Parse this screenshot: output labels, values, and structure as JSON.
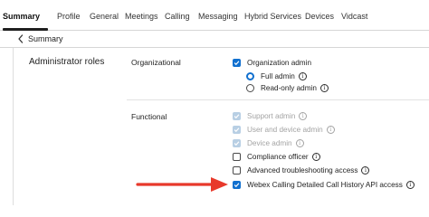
{
  "tabs": [
    {
      "label": "Summary",
      "active": true
    },
    {
      "label": "Profile"
    },
    {
      "label": "General"
    },
    {
      "label": "Meetings"
    },
    {
      "label": "Calling"
    },
    {
      "label": "Messaging"
    },
    {
      "label": "Hybrid Services"
    },
    {
      "label": "Devices"
    },
    {
      "label": "Vidcast"
    }
  ],
  "breadcrumb": {
    "label": "Summary"
  },
  "section": {
    "title": "Administrator roles"
  },
  "organizational": {
    "label": "Organizational",
    "org_admin": {
      "label": "Organization admin",
      "checked": true
    },
    "full_admin": {
      "label": "Full admin",
      "selected": true
    },
    "readonly_admin": {
      "label": "Read-only admin",
      "selected": false
    }
  },
  "functional": {
    "label": "Functional",
    "items": [
      {
        "label": "Support admin",
        "checked": true,
        "disabled": true
      },
      {
        "label": "User and device admin",
        "checked": true,
        "disabled": true
      },
      {
        "label": "Device admin",
        "checked": true,
        "disabled": true
      },
      {
        "label": "Compliance officer",
        "checked": false,
        "disabled": false
      },
      {
        "label": "Advanced troubleshooting access",
        "checked": false,
        "disabled": false
      },
      {
        "label": "Webex Calling Detailed Call History API access",
        "checked": true,
        "disabled": false
      }
    ]
  },
  "icons": {
    "info": "i"
  },
  "colors": {
    "accent": "#1170cf",
    "annotation_arrow": "#e8392b",
    "disabled_check": "#b8cfe4"
  }
}
